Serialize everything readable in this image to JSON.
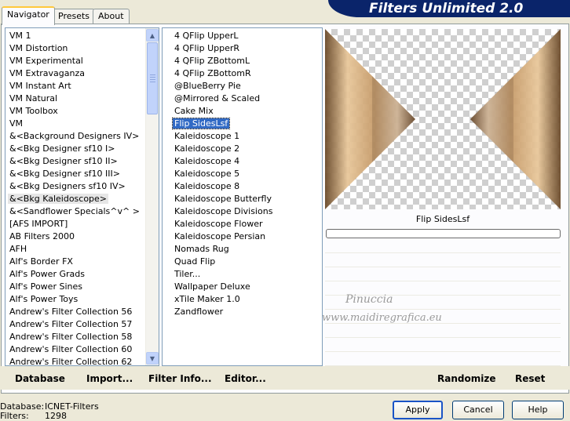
{
  "header": {
    "title": "Filters Unlimited 2.0"
  },
  "tabs": [
    {
      "label": "Navigator",
      "active": true
    },
    {
      "label": "Presets",
      "active": false
    },
    {
      "label": "About",
      "active": false
    }
  ],
  "categories": {
    "items": [
      "VM 1",
      "VM Distortion",
      "VM Experimental",
      "VM Extravaganza",
      "VM Instant Art",
      "VM Natural",
      "VM Toolbox",
      "VM",
      "&<Background Designers IV>",
      "&<Bkg Designer sf10 I>",
      "&<Bkg Designer sf10 II>",
      "&<Bkg Designer sf10 III>",
      "&<Bkg Designers sf10 IV>",
      "&<Bkg Kaleidoscope>",
      "&<Sandflower Specials^v^ >",
      "[AFS IMPORT]",
      "AB Filters 2000",
      "AFH",
      "Alf's Border FX",
      "Alf's Power Grads",
      "Alf's Power Sines",
      "Alf's Power Toys",
      "Andrew's Filter Collection 56",
      "Andrew's Filter Collection 57",
      "Andrew's Filter Collection 58",
      "Andrew's Filter Collection 60",
      "Andrew's Filter Collection 62"
    ],
    "selected_index": 13
  },
  "filters": {
    "items": [
      "4 QFlip UpperL",
      "4 QFlip UpperR",
      "4 QFlip ZBottomL",
      "4 QFlip ZBottomR",
      "@BlueBerry Pie",
      "@Mirrored & Scaled",
      "Cake Mix",
      "Flip SidesLsf",
      "Kaleidoscope 1",
      "Kaleidoscope 2",
      "Kaleidoscope 4",
      "Kaleidoscope 5",
      "Kaleidoscope 8",
      "Kaleidoscope Butterfly",
      "Kaleidoscope Divisions",
      "Kaleidoscope Flower",
      "Kaleidoscope Persian",
      "Nomads Rug",
      "Quad Flip",
      "Tiler...",
      "Wallpaper Deluxe",
      "xTile Maker 1.0",
      "Zandflower"
    ],
    "selected_index": 7
  },
  "preview": {
    "filter_name": "Flip SidesLsf",
    "progress_percent": 0,
    "watermark_name": "Pinuccia",
    "watermark_url": "www.maidiregrafica.eu"
  },
  "link_buttons": {
    "database": "Database",
    "import": "Import...",
    "filter_info": "Filter Info...",
    "editor": "Editor...",
    "randomize": "Randomize",
    "reset": "Reset"
  },
  "status": {
    "database_label": "Database:",
    "database_value": "ICNET-Filters",
    "filters_label": "Filters:",
    "filters_value": "1298"
  },
  "dialog_buttons": {
    "apply": "Apply",
    "cancel": "Cancel",
    "help": "Help"
  },
  "colors": {
    "banner": "#0a246a",
    "selection": "#316ac5"
  }
}
